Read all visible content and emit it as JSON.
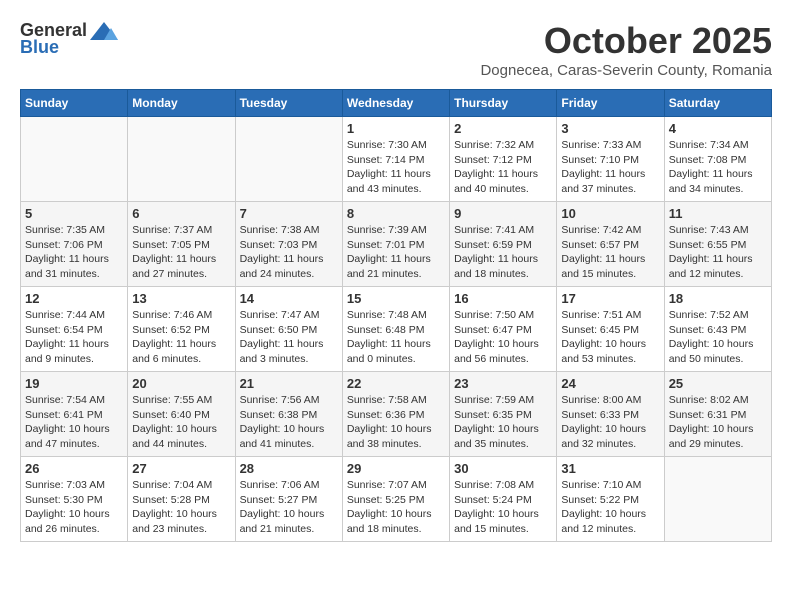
{
  "header": {
    "logo_general": "General",
    "logo_blue": "Blue",
    "month_title": "October 2025",
    "location": "Dognecea, Caras-Severin County, Romania"
  },
  "weekdays": [
    "Sunday",
    "Monday",
    "Tuesday",
    "Wednesday",
    "Thursday",
    "Friday",
    "Saturday"
  ],
  "weeks": [
    [
      {
        "day": "",
        "info": ""
      },
      {
        "day": "",
        "info": ""
      },
      {
        "day": "",
        "info": ""
      },
      {
        "day": "1",
        "info": "Sunrise: 7:30 AM\nSunset: 7:14 PM\nDaylight: 11 hours\nand 43 minutes."
      },
      {
        "day": "2",
        "info": "Sunrise: 7:32 AM\nSunset: 7:12 PM\nDaylight: 11 hours\nand 40 minutes."
      },
      {
        "day": "3",
        "info": "Sunrise: 7:33 AM\nSunset: 7:10 PM\nDaylight: 11 hours\nand 37 minutes."
      },
      {
        "day": "4",
        "info": "Sunrise: 7:34 AM\nSunset: 7:08 PM\nDaylight: 11 hours\nand 34 minutes."
      }
    ],
    [
      {
        "day": "5",
        "info": "Sunrise: 7:35 AM\nSunset: 7:06 PM\nDaylight: 11 hours\nand 31 minutes."
      },
      {
        "day": "6",
        "info": "Sunrise: 7:37 AM\nSunset: 7:05 PM\nDaylight: 11 hours\nand 27 minutes."
      },
      {
        "day": "7",
        "info": "Sunrise: 7:38 AM\nSunset: 7:03 PM\nDaylight: 11 hours\nand 24 minutes."
      },
      {
        "day": "8",
        "info": "Sunrise: 7:39 AM\nSunset: 7:01 PM\nDaylight: 11 hours\nand 21 minutes."
      },
      {
        "day": "9",
        "info": "Sunrise: 7:41 AM\nSunset: 6:59 PM\nDaylight: 11 hours\nand 18 minutes."
      },
      {
        "day": "10",
        "info": "Sunrise: 7:42 AM\nSunset: 6:57 PM\nDaylight: 11 hours\nand 15 minutes."
      },
      {
        "day": "11",
        "info": "Sunrise: 7:43 AM\nSunset: 6:55 PM\nDaylight: 11 hours\nand 12 minutes."
      }
    ],
    [
      {
        "day": "12",
        "info": "Sunrise: 7:44 AM\nSunset: 6:54 PM\nDaylight: 11 hours\nand 9 minutes."
      },
      {
        "day": "13",
        "info": "Sunrise: 7:46 AM\nSunset: 6:52 PM\nDaylight: 11 hours\nand 6 minutes."
      },
      {
        "day": "14",
        "info": "Sunrise: 7:47 AM\nSunset: 6:50 PM\nDaylight: 11 hours\nand 3 minutes."
      },
      {
        "day": "15",
        "info": "Sunrise: 7:48 AM\nSunset: 6:48 PM\nDaylight: 11 hours\nand 0 minutes."
      },
      {
        "day": "16",
        "info": "Sunrise: 7:50 AM\nSunset: 6:47 PM\nDaylight: 10 hours\nand 56 minutes."
      },
      {
        "day": "17",
        "info": "Sunrise: 7:51 AM\nSunset: 6:45 PM\nDaylight: 10 hours\nand 53 minutes."
      },
      {
        "day": "18",
        "info": "Sunrise: 7:52 AM\nSunset: 6:43 PM\nDaylight: 10 hours\nand 50 minutes."
      }
    ],
    [
      {
        "day": "19",
        "info": "Sunrise: 7:54 AM\nSunset: 6:41 PM\nDaylight: 10 hours\nand 47 minutes."
      },
      {
        "day": "20",
        "info": "Sunrise: 7:55 AM\nSunset: 6:40 PM\nDaylight: 10 hours\nand 44 minutes."
      },
      {
        "day": "21",
        "info": "Sunrise: 7:56 AM\nSunset: 6:38 PM\nDaylight: 10 hours\nand 41 minutes."
      },
      {
        "day": "22",
        "info": "Sunrise: 7:58 AM\nSunset: 6:36 PM\nDaylight: 10 hours\nand 38 minutes."
      },
      {
        "day": "23",
        "info": "Sunrise: 7:59 AM\nSunset: 6:35 PM\nDaylight: 10 hours\nand 35 minutes."
      },
      {
        "day": "24",
        "info": "Sunrise: 8:00 AM\nSunset: 6:33 PM\nDaylight: 10 hours\nand 32 minutes."
      },
      {
        "day": "25",
        "info": "Sunrise: 8:02 AM\nSunset: 6:31 PM\nDaylight: 10 hours\nand 29 minutes."
      }
    ],
    [
      {
        "day": "26",
        "info": "Sunrise: 7:03 AM\nSunset: 5:30 PM\nDaylight: 10 hours\nand 26 minutes."
      },
      {
        "day": "27",
        "info": "Sunrise: 7:04 AM\nSunset: 5:28 PM\nDaylight: 10 hours\nand 23 minutes."
      },
      {
        "day": "28",
        "info": "Sunrise: 7:06 AM\nSunset: 5:27 PM\nDaylight: 10 hours\nand 21 minutes."
      },
      {
        "day": "29",
        "info": "Sunrise: 7:07 AM\nSunset: 5:25 PM\nDaylight: 10 hours\nand 18 minutes."
      },
      {
        "day": "30",
        "info": "Sunrise: 7:08 AM\nSunset: 5:24 PM\nDaylight: 10 hours\nand 15 minutes."
      },
      {
        "day": "31",
        "info": "Sunrise: 7:10 AM\nSunset: 5:22 PM\nDaylight: 10 hours\nand 12 minutes."
      },
      {
        "day": "",
        "info": ""
      }
    ]
  ]
}
